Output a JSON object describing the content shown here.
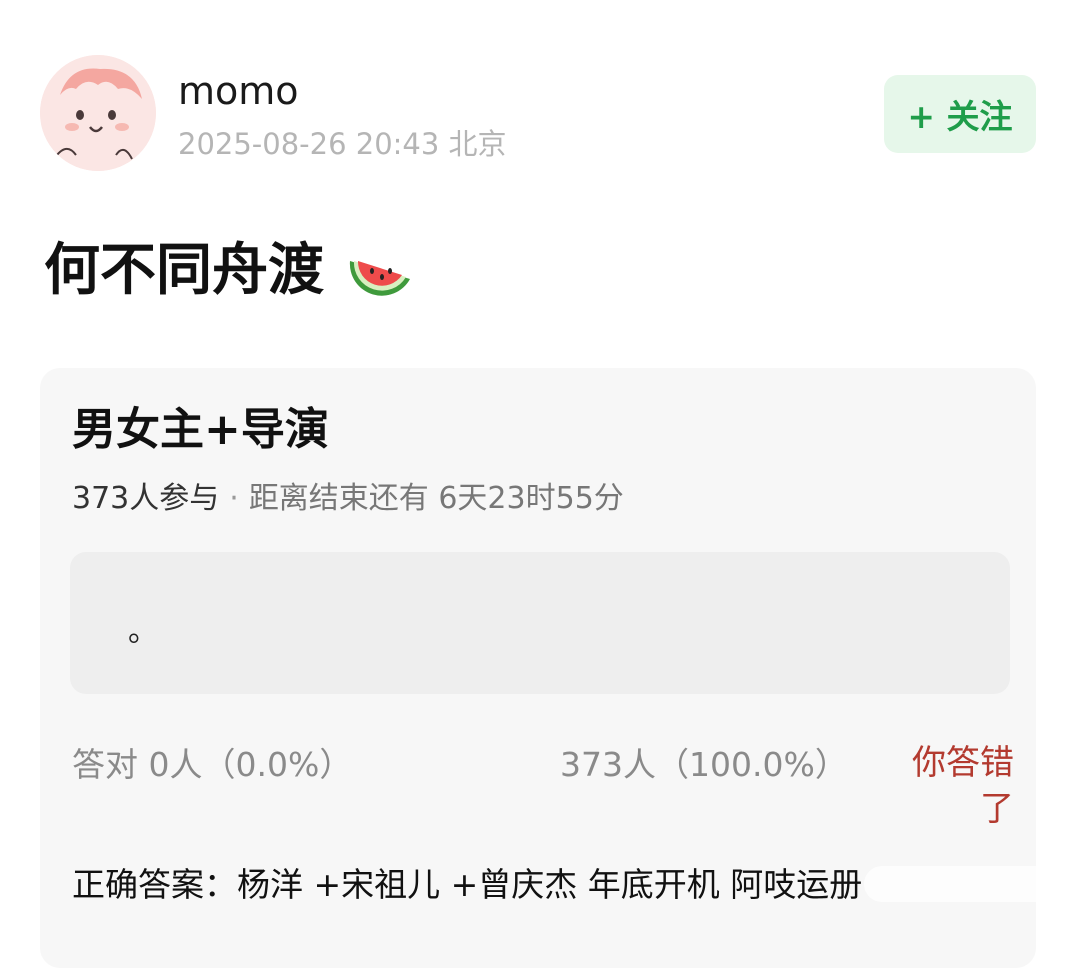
{
  "post": {
    "author": "momo",
    "meta": "2025-08-26 20:43  北京",
    "follow_label": "+ 关注",
    "text": "何不同舟渡",
    "text_emoji": "watermelon-emoji"
  },
  "poll": {
    "title": "男女主+导演",
    "participants": "373人参与",
    "separator": "·",
    "deadline": "距离结束还有 6天23时55分",
    "option_text": "。",
    "correct_stat": "答对  0人（0.0%）",
    "wrong_stat": "373人（100.0%）",
    "result_label": "你答错了",
    "answer": "正确答案：杨洋 +宋祖儿 +曾庆杰 年底开机 阿吱运册"
  },
  "colors": {
    "follow_bg": "#e6f7ea",
    "follow_text": "#1f9d4a",
    "wrong_text": "#b33a2f",
    "card_bg": "#f7f7f7"
  }
}
